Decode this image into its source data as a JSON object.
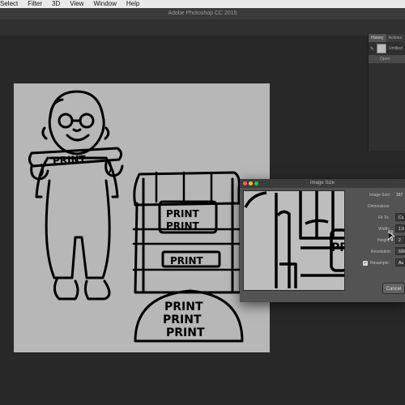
{
  "menubar": {
    "items": [
      "Select",
      "Filter",
      "3D",
      "View",
      "Window",
      "Help"
    ]
  },
  "app": {
    "title": "Adobe Photoshop CC 2015"
  },
  "history_panel": {
    "tabs": [
      "History",
      "Actions"
    ],
    "snapshot_label": "Untitled",
    "steps": [
      "Open"
    ]
  },
  "dialog": {
    "title": "Image Size",
    "image_size_label": "Image Size:",
    "image_size_value": "167",
    "dimensions_label": "Dimensions:",
    "fit_to_label": "Fit To:",
    "fit_to_value": "Cu",
    "width_label": "Width:",
    "width_value": "1.9",
    "height_label": "Height:",
    "height_value": "2",
    "resolution_label": "Resolution:",
    "resolution_value": "600",
    "resample_label": "Resample:",
    "resample_value": "Au",
    "cancel_label": "Cancel"
  },
  "canvas": {
    "press_text_1": "PRINT",
    "press_text_2": "PRINT",
    "press_text_3": "PRINT",
    "base_text_1": "PRINT",
    "base_text_2": "PRINT",
    "base_text_3": "PRINT",
    "sign_text": "PRINT",
    "preview_text": "PR"
  },
  "colors": {
    "canvas_bg": "#b7b7b7",
    "workspace_bg": "#282828",
    "dialog_bg": "#535353",
    "traffic_red": "#ff5f57",
    "traffic_yellow": "#febc2e",
    "traffic_green": "#28c840"
  }
}
